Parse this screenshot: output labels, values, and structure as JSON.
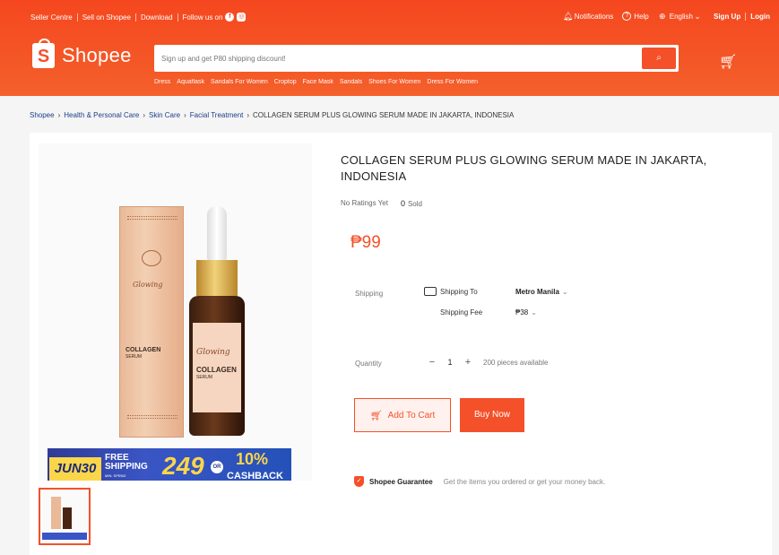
{
  "topnav": {
    "left": [
      "Seller Centre",
      "Sell on Shopee",
      "Download",
      "Follow us on"
    ],
    "right": {
      "notifications": "Notifications",
      "help": "Help",
      "language": "English",
      "signup": "Sign Up",
      "login": "Login"
    }
  },
  "header": {
    "logo_letter": "S",
    "logo_text": "Shopee",
    "search_placeholder": "Sign up and get P80 shipping discount!",
    "suggestions": [
      "Dress",
      "Aquaflask",
      "Sandals For Women",
      "Croptop",
      "Face Mask",
      "Sandals",
      "Shoes For Women",
      "Dress For Women"
    ]
  },
  "breadcrumb": [
    "Shopee",
    "Health & Personal Care",
    "Skin Care",
    "Facial Treatment"
  ],
  "breadcrumb_current": "COLLAGEN SERUM PLUS GLOWING SERUM MADE IN JAKARTA, INDONESIA",
  "product": {
    "title": "COLLAGEN SERUM PLUS GLOWING SERUM MADE IN JAKARTA, INDONESIA",
    "ratings": "No Ratings Yet",
    "sold_count": "0",
    "sold_label": "Sold",
    "price": "₱99",
    "image_text": {
      "box_script": "Glowing",
      "box_name": "COLLAGEN",
      "box_sub": "SERUM",
      "bottle_script": "Glowing",
      "bottle_name": "COLLAGEN",
      "bottle_sub": "SERUM"
    },
    "banner": {
      "date": "JUN30",
      "free1": "FREE",
      "free2": "SHIPPING",
      "min_spend": "MIN. SPEND",
      "amount": "249",
      "or": "OR",
      "percent": "10%",
      "cashback": "CASHBACK"
    }
  },
  "shipping": {
    "label": "Shipping",
    "to_label": "Shipping To",
    "to_value": "Metro Manila",
    "fee_label": "Shipping Fee",
    "fee_value": "₱38"
  },
  "quantity": {
    "label": "Quantity",
    "minus": "−",
    "value": "1",
    "plus": "+",
    "available": "200 pieces available"
  },
  "actions": {
    "add_to_cart": "Add To Cart",
    "buy_now": "Buy Now"
  },
  "guarantee": {
    "title": "Shopee Guarantee",
    "text": "Get the items you ordered or get your money back."
  },
  "colors": {
    "brand": "#f4502a",
    "link": "#1a3f8a"
  }
}
